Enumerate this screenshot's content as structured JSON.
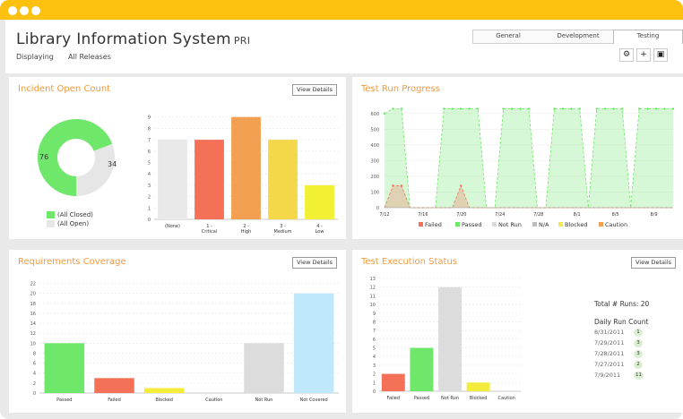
{
  "header": {
    "title": "Library Information System",
    "title_suffix": "PRI",
    "displaying_label": "Displaying",
    "displaying_value": "All Releases",
    "tabs": [
      {
        "label": "General"
      },
      {
        "label": "Development"
      },
      {
        "label": "Testing",
        "active": true
      }
    ],
    "tools": {
      "settings": "⚙",
      "add": "+",
      "image": "▣"
    }
  },
  "incident": {
    "title": "Incident Open Count",
    "view_details": "View Details",
    "donut": {
      "closed": 76,
      "open": 34,
      "legend": [
        {
          "label": "(All Closed)",
          "color": "#6fe76a"
        },
        {
          "label": "(All Open)",
          "color": "#e6e6e6"
        }
      ]
    },
    "chart_data": {
      "type": "bar",
      "categories": [
        "(None)",
        "1 - Critical",
        "2 - High",
        "3 - Medium",
        "4 - Low"
      ],
      "values": [
        7,
        7,
        9,
        7,
        3
      ],
      "colors": [
        "#e9e9e9",
        "#f47157",
        "#f29f52",
        "#f4d84a",
        "#f2f032"
      ],
      "ylim": [
        0,
        10
      ],
      "yticks": [
        0,
        1,
        2,
        3,
        4,
        5,
        6,
        7,
        8,
        9
      ]
    }
  },
  "testrun": {
    "title": "Test Run Progress",
    "chart_data": {
      "type": "area",
      "x_labels": [
        "7/12",
        "7/16",
        "7/20",
        "7/24",
        "7/28",
        "8/1",
        "8/5",
        "8/9"
      ],
      "ylim": [
        0,
        650
      ],
      "yticks": [
        0,
        100,
        200,
        300,
        400,
        500,
        600
      ],
      "series": [
        {
          "name": "Passed",
          "color": "#6fe76a",
          "values": [
            600,
            630,
            630,
            0,
            0,
            0,
            0,
            630,
            630,
            630,
            630,
            630,
            0,
            0,
            630,
            630,
            630,
            630,
            0,
            0,
            630,
            630,
            630,
            630,
            0,
            630,
            630,
            630,
            630,
            0,
            630,
            630,
            630,
            630,
            630
          ]
        },
        {
          "name": "Failed",
          "color": "#f47157",
          "values": [
            0,
            140,
            140,
            0,
            0,
            0,
            0,
            0,
            0,
            140,
            0,
            0,
            0,
            0,
            0,
            0,
            0,
            0,
            0,
            0,
            0,
            0,
            0,
            0,
            0,
            0,
            0,
            0,
            0,
            0,
            0,
            0,
            0,
            0,
            0
          ]
        }
      ],
      "legend": [
        {
          "label": "Failed",
          "color": "#f47157"
        },
        {
          "label": "Passed",
          "color": "#6fe76a"
        },
        {
          "label": "Not Run",
          "color": "#d9d9d9"
        },
        {
          "label": "N/A",
          "color": "#bdbdbd"
        },
        {
          "label": "Blocked",
          "color": "#f4e84a"
        },
        {
          "label": "Caution",
          "color": "#f29f52"
        }
      ]
    }
  },
  "requirements": {
    "title": "Requirements Coverage",
    "view_details": "View Details",
    "chart_data": {
      "type": "bar",
      "categories": [
        "Passed",
        "Failed",
        "Blocked",
        "Caution",
        "Not Run",
        "Not Covered"
      ],
      "values": [
        10,
        3,
        1,
        0,
        10,
        20
      ],
      "colors": [
        "#6fe76a",
        "#f47157",
        "#f4ec3a",
        "#f29f52",
        "#dcdcdc",
        "#bfe8fb"
      ],
      "ylim": [
        0,
        23
      ],
      "yticks": [
        0,
        2,
        4,
        6,
        8,
        10,
        12,
        14,
        16,
        18,
        20,
        22
      ]
    }
  },
  "execution": {
    "title": "Test Execution Status",
    "view_details": "View Details",
    "chart_data": {
      "type": "bar",
      "categories": [
        "Failed",
        "Passed",
        "Not Run",
        "Blocked",
        "Caution"
      ],
      "values": [
        2,
        5,
        12,
        1,
        0
      ],
      "colors": [
        "#f47157",
        "#6fe76a",
        "#dcdcdc",
        "#f4ec3a",
        "#f29f52"
      ],
      "ylim": [
        0,
        13
      ],
      "yticks": [
        0,
        1,
        2,
        3,
        4,
        5,
        6,
        7,
        8,
        9,
        10,
        11,
        12,
        13
      ]
    },
    "total_label": "Total # Runs: 20",
    "daily_title": "Daily Run Count",
    "daily": [
      {
        "date": "8/31/2011",
        "count": "1"
      },
      {
        "date": "7/29/2011",
        "count": "3"
      },
      {
        "date": "7/28/2011",
        "count": "3"
      },
      {
        "date": "7/27/2011",
        "count": "2"
      },
      {
        "date": "7/9/2011",
        "count": "11"
      }
    ]
  }
}
